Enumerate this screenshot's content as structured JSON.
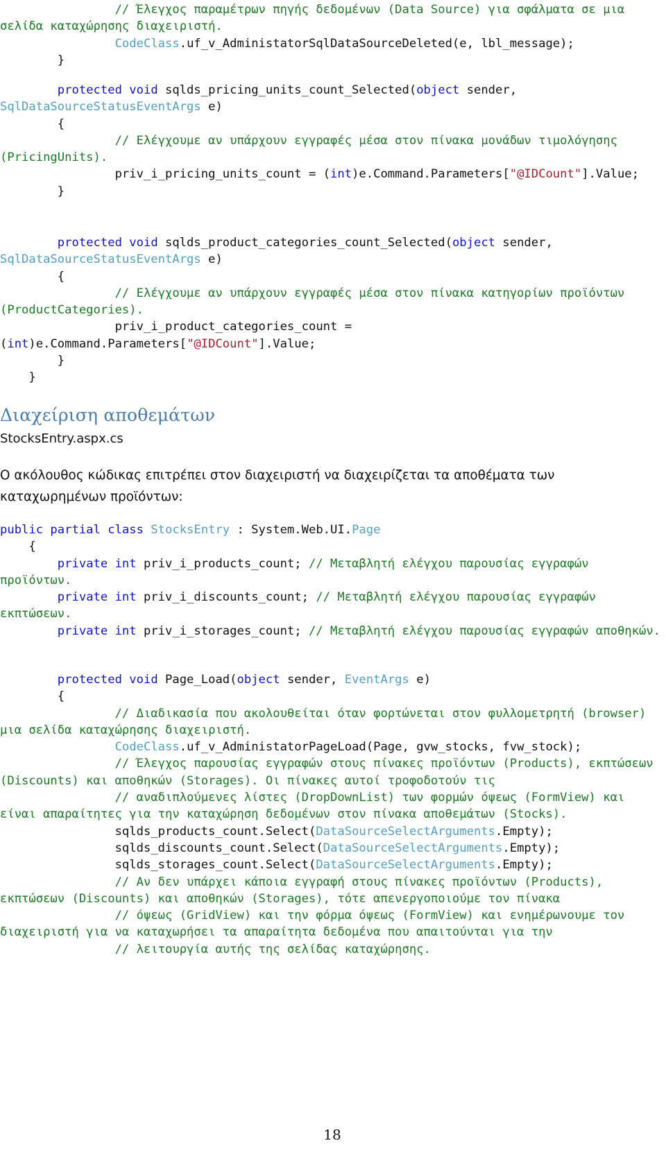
{
  "document": {
    "page_number": "18",
    "colors": {
      "comment": "#1f7a27",
      "keyword": "#1015c8",
      "type": "#54a0c4",
      "string": "#a8212c",
      "heading": "#4a7bb0",
      "body": "#111111",
      "background": "#ffffff"
    }
  },
  "code_top": {
    "lines": [
      {
        "indent": 8,
        "spans": [
          {
            "t": "comment",
            "v": "// Έλεγχος παραμέτρων πηγής δεδομένων (Data Source) για σφάλματα σε μια σελίδα καταχώρησης διαχειριστή."
          }
        ]
      },
      {
        "indent": 8,
        "spans": [
          {
            "t": "type",
            "v": "CodeClass"
          },
          {
            "t": "plain",
            "v": ".uf_v_AdministatorSqlDataSourceDeleted(e, lbl_message);"
          }
        ]
      },
      {
        "indent": 4,
        "spans": [
          {
            "t": "plain",
            "v": "}"
          }
        ]
      }
    ]
  },
  "code_pricing": {
    "lines": [
      {
        "indent": 4,
        "spans": [
          {
            "t": "keyword",
            "v": "protected void "
          },
          {
            "t": "plain",
            "v": "sqlds_pricing_units_count_Selected("
          },
          {
            "t": "keyword",
            "v": "object"
          },
          {
            "t": "plain",
            "v": " sender, "
          },
          {
            "t": "type",
            "v": "SqlDataSourceStatusEventArgs"
          },
          {
            "t": "plain",
            "v": " e)"
          }
        ]
      },
      {
        "indent": 4,
        "spans": [
          {
            "t": "plain",
            "v": "{"
          }
        ]
      },
      {
        "indent": 8,
        "spans": [
          {
            "t": "comment",
            "v": "// Ελέγχουμε αν υπάρχουν εγγραφές μέσα στον πίνακα μονάδων τιμολόγησης (PricingUnits)."
          }
        ]
      },
      {
        "indent": 8,
        "spans": [
          {
            "t": "plain",
            "v": "priv_i_pricing_units_count = ("
          },
          {
            "t": "keyword",
            "v": "int"
          },
          {
            "t": "plain",
            "v": ")e.Command.Parameters["
          },
          {
            "t": "string",
            "v": "\"@IDCount\""
          },
          {
            "t": "plain",
            "v": "].Value;"
          }
        ]
      },
      {
        "indent": 4,
        "spans": [
          {
            "t": "plain",
            "v": "}"
          }
        ]
      }
    ]
  },
  "code_categories": {
    "lines": [
      {
        "indent": 4,
        "spans": [
          {
            "t": "keyword",
            "v": "protected void "
          },
          {
            "t": "plain",
            "v": "sqlds_product_categories_count_Selected("
          },
          {
            "t": "keyword",
            "v": "object"
          },
          {
            "t": "plain",
            "v": " sender, "
          },
          {
            "t": "type",
            "v": "SqlDataSourceStatusEventArgs"
          },
          {
            "t": "plain",
            "v": " e)"
          }
        ]
      },
      {
        "indent": 4,
        "spans": [
          {
            "t": "plain",
            "v": "{"
          }
        ]
      },
      {
        "indent": 8,
        "spans": [
          {
            "t": "comment",
            "v": "// Ελέγχουμε αν υπάρχουν εγγραφές μέσα στον πίνακα κατηγορίων προϊόντων (ProductCategories)."
          }
        ]
      },
      {
        "indent": 8,
        "spans": [
          {
            "t": "plain",
            "v": "priv_i_product_categories_count = ("
          },
          {
            "t": "keyword",
            "v": "int"
          },
          {
            "t": "plain",
            "v": ")e.Command.Parameters["
          },
          {
            "t": "string",
            "v": "\"@IDCount\""
          },
          {
            "t": "plain",
            "v": "].Value;"
          }
        ]
      },
      {
        "indent": 4,
        "spans": [
          {
            "t": "plain",
            "v": "}"
          }
        ]
      },
      {
        "indent": 2,
        "spans": [
          {
            "t": "plain",
            "v": "}"
          }
        ]
      }
    ]
  },
  "section": {
    "heading": "Διαχείριση αποθεμάτων",
    "file_name": "StocksEntry.aspx.cs",
    "intro": "Ο ακόλουθος κώδικας επιτρέπει στον διαχειριστή να διαχειρίζεται τα αποθέματα των καταχωρημένων προϊόντων:"
  },
  "code_class": {
    "lines": [
      {
        "indent": 0,
        "spans": [
          {
            "t": "keyword",
            "v": "public partial class "
          },
          {
            "t": "type",
            "v": "StocksEntry"
          },
          {
            "t": "plain",
            "v": " : System.Web.UI."
          },
          {
            "t": "type",
            "v": "Page"
          }
        ]
      },
      {
        "indent": 2,
        "spans": [
          {
            "t": "plain",
            "v": "{"
          }
        ]
      },
      {
        "indent": 4,
        "spans": [
          {
            "t": "keyword",
            "v": "private int "
          },
          {
            "t": "plain",
            "v": "priv_i_products_count; "
          },
          {
            "t": "comment",
            "v": "// Μεταβλητή ελέγχου παρουσίας εγγραφών προϊόντων."
          }
        ]
      },
      {
        "indent": 4,
        "spans": [
          {
            "t": "keyword",
            "v": "private int "
          },
          {
            "t": "plain",
            "v": "priv_i_discounts_count; "
          },
          {
            "t": "comment",
            "v": "// Μεταβλητή ελέγχου παρουσίας εγγραφών εκπτώσεων."
          }
        ]
      },
      {
        "indent": 4,
        "spans": [
          {
            "t": "keyword",
            "v": "private int "
          },
          {
            "t": "plain",
            "v": "priv_i_storages_count; "
          },
          {
            "t": "comment",
            "v": "// Μεταβλητή ελέγχου παρουσίας εγγραφών αποθηκών."
          }
        ]
      }
    ]
  },
  "code_pageload": {
    "lines": [
      {
        "indent": 4,
        "spans": [
          {
            "t": "keyword",
            "v": "protected void "
          },
          {
            "t": "plain",
            "v": "Page_Load("
          },
          {
            "t": "keyword",
            "v": "object"
          },
          {
            "t": "plain",
            "v": " sender, "
          },
          {
            "t": "type",
            "v": "EventArgs"
          },
          {
            "t": "plain",
            "v": " e)"
          }
        ]
      },
      {
        "indent": 4,
        "spans": [
          {
            "t": "plain",
            "v": "{"
          }
        ]
      },
      {
        "indent": 8,
        "spans": [
          {
            "t": "comment",
            "v": "// Διαδικασία που ακολουθείται όταν φορτώνεται στον φυλλομετρητή (browser) μια σελίδα καταχώρησης διαχειριστή."
          }
        ]
      },
      {
        "indent": 8,
        "spans": [
          {
            "t": "type",
            "v": "CodeClass"
          },
          {
            "t": "plain",
            "v": ".uf_v_AdministatorPageLoad(Page, gvw_stocks, fvw_stock);"
          }
        ]
      },
      {
        "indent": 0,
        "spans": [
          {
            "t": "plain",
            "v": ""
          }
        ]
      },
      {
        "indent": 8,
        "spans": [
          {
            "t": "comment",
            "v": "// Έλεγχος παρουσίας εγγραφών στους πίνακες προϊόντων (Products), εκπτώσεων (Discounts) και αποθηκών (Storages). Οι πίνακες αυτοί τροφοδοτούν τις"
          }
        ]
      },
      {
        "indent": 8,
        "spans": [
          {
            "t": "comment",
            "v": "// αναδιπλούμενες λίστες (DropDownList) των φορμών όψεως (FormView) και είναι απαραίτητες για την καταχώρηση δεδομένων στον πίνακα αποθεμάτων (Stocks)."
          }
        ]
      },
      {
        "indent": 8,
        "spans": [
          {
            "t": "plain",
            "v": "sqlds_products_count.Select("
          },
          {
            "t": "type",
            "v": "DataSourceSelectArguments"
          },
          {
            "t": "plain",
            "v": ".Empty);"
          }
        ]
      },
      {
        "indent": 8,
        "spans": [
          {
            "t": "plain",
            "v": "sqlds_discounts_count.Select("
          },
          {
            "t": "type",
            "v": "DataSourceSelectArguments"
          },
          {
            "t": "plain",
            "v": ".Empty);"
          }
        ]
      },
      {
        "indent": 8,
        "spans": [
          {
            "t": "plain",
            "v": "sqlds_storages_count.Select("
          },
          {
            "t": "type",
            "v": "DataSourceSelectArguments"
          },
          {
            "t": "plain",
            "v": ".Empty);"
          }
        ]
      },
      {
        "indent": 0,
        "spans": [
          {
            "t": "plain",
            "v": ""
          }
        ]
      },
      {
        "indent": 8,
        "spans": [
          {
            "t": "comment",
            "v": "// Αν δεν υπάρχει κάποια εγγραφή στους πίνακες προϊόντων (Products), εκπτώσεων (Discounts) και αποθηκών (Storages), τότε απενεργοποιούμε τον πίνακα"
          }
        ]
      },
      {
        "indent": 8,
        "spans": [
          {
            "t": "comment",
            "v": "// όψεως (GridView) και την φόρμα όψεως (FormView) και ενημέρωνουμε τον διαχειριστή για να καταχωρήσει τα απαραίτητα δεδομένα που απαιτούνται για την"
          }
        ]
      },
      {
        "indent": 8,
        "spans": [
          {
            "t": "comment",
            "v": "// λειτουργία αυτής της σελίδας καταχώρησης."
          }
        ]
      }
    ]
  }
}
